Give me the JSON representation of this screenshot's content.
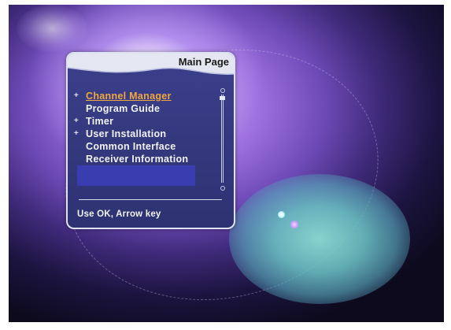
{
  "menu": {
    "title": "Main Page",
    "items": [
      {
        "label": "Channel Manager",
        "bullet": "+",
        "selected": true
      },
      {
        "label": "Program Guide",
        "bullet": "",
        "selected": false
      },
      {
        "label": "Timer",
        "bullet": "+",
        "selected": false
      },
      {
        "label": "User Installation",
        "bullet": "+",
        "selected": false
      },
      {
        "label": "Common Interface",
        "bullet": "",
        "selected": false
      },
      {
        "label": "Receiver Information",
        "bullet": "",
        "selected": false
      }
    ],
    "hint": "Use OK, Arrow key"
  },
  "colors": {
    "panel": "#34397e",
    "selected_text": "#f0a840",
    "header": "#dfe2f2"
  }
}
